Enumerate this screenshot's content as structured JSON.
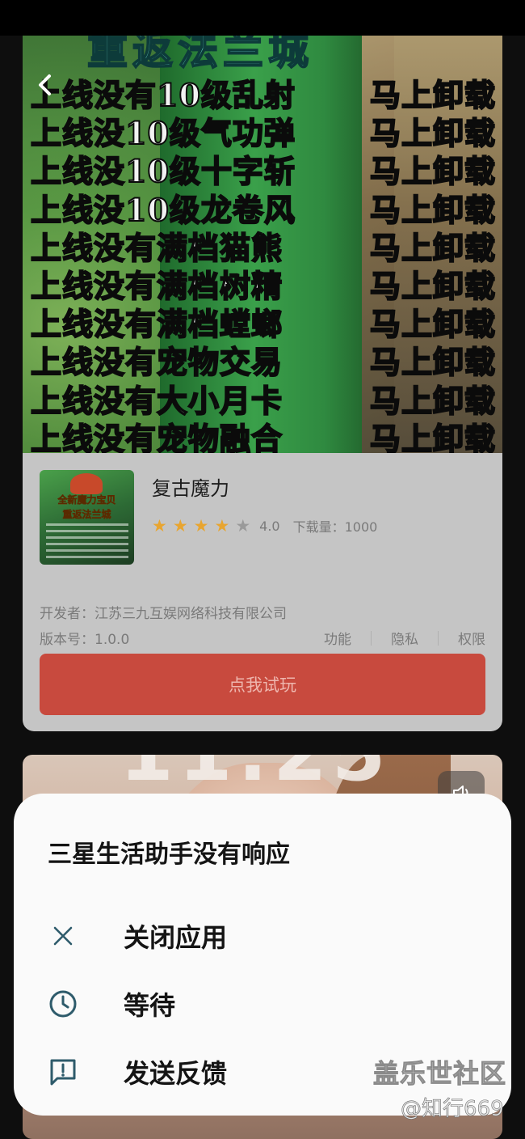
{
  "banner": {
    "title": "重返法兰城",
    "lines": [
      {
        "left": "上线没有10级乱射",
        "right": "马上卸载"
      },
      {
        "left": "上线没10级气功弹",
        "right": "马上卸载"
      },
      {
        "left": "上线没10级十字斩",
        "right": "马上卸载"
      },
      {
        "left": "上线没10级龙卷风",
        "right": "马上卸载"
      },
      {
        "left": "上线没有满档猫熊",
        "right": "马上卸载"
      },
      {
        "left": "上线没有满档树精",
        "right": "马上卸载"
      },
      {
        "left": "上线没有满档螳螂",
        "right": "马上卸载"
      },
      {
        "left": "上线没有宠物交易",
        "right": "马上卸载"
      },
      {
        "left": "上线没有大小月卡",
        "right": "马上卸载"
      },
      {
        "left": "上线没有宠物融合",
        "right": "马上卸载"
      }
    ]
  },
  "app": {
    "icon_title_1": "全新魔力宝贝",
    "icon_title_2": "重返法兰城",
    "name": "复古魔力",
    "rating": 4.0,
    "rating_text": "4.0",
    "stars_filled": 4,
    "stars_total": 5,
    "downloads_text": "下载量：1000",
    "developer_text": "开发者：江苏三九互娱网络科技有限公司",
    "version_text": "版本号：1.0.0",
    "links": [
      "功能",
      "隐私",
      "权限"
    ],
    "try_button": "点我试玩"
  },
  "dialog": {
    "title": "三星生活助手没有响应",
    "options": [
      {
        "label": "关闭应用",
        "icon": "close-icon"
      },
      {
        "label": "等待",
        "icon": "clock-icon"
      },
      {
        "label": "发送反馈",
        "icon": "feedback-icon"
      }
    ]
  },
  "watermark": {
    "main": "盖乐世社区",
    "sub": "@知行669"
  },
  "colors": {
    "try_button": "#c84a3e",
    "star_filled": "#e8a530",
    "star_empty": "#9a9a9a",
    "icon_teal": "#2e5b6b"
  }
}
